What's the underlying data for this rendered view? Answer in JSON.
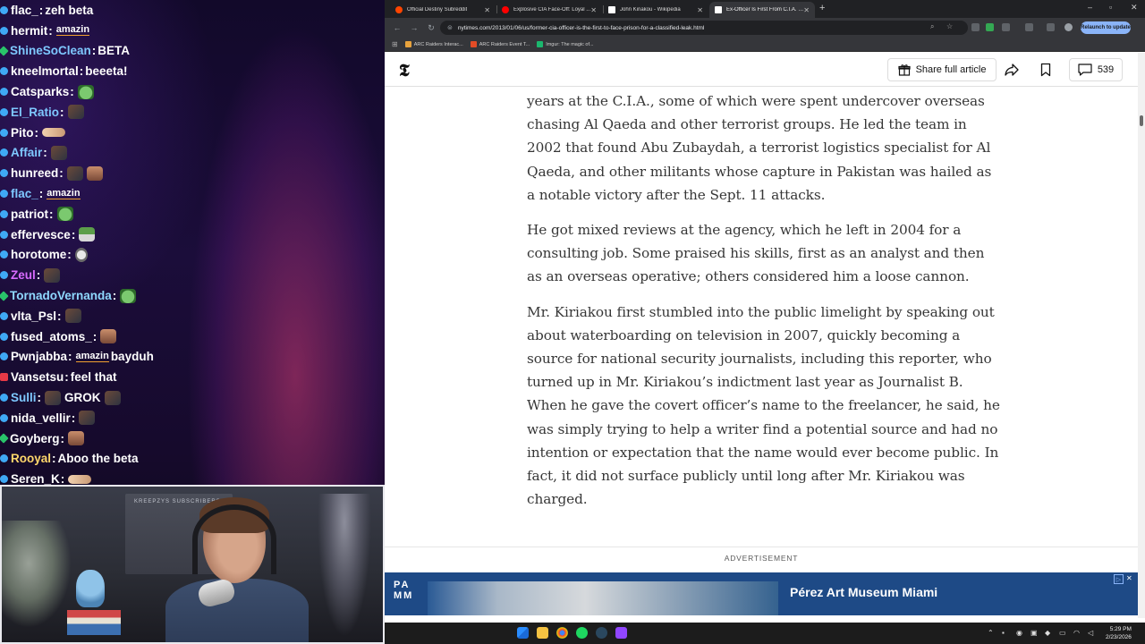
{
  "chat": [
    {
      "user": "flac_",
      "user_color": "#ffffff",
      "badge": "blue",
      "text": "zeh beta",
      "emotes": []
    },
    {
      "user": "hermit",
      "user_color": "#ffffff",
      "badge": "blue",
      "text": "",
      "emotes": [
        "amazin"
      ]
    },
    {
      "user": "ShineSoClean",
      "user_color": "#7ec8ff",
      "badge": "green",
      "text": "BETA",
      "emotes": []
    },
    {
      "user": "kneelmortal",
      "user_color": "#ffffff",
      "badge": "blue",
      "text": "beeeta!",
      "emotes": []
    },
    {
      "user": "Catsparks",
      "user_color": "#ffffff",
      "badge": "blue",
      "text": "",
      "emotes": [
        "frog"
      ]
    },
    {
      "user": "El_Ratio",
      "user_color": "#7ec8ff",
      "badge": "blue",
      "text": "",
      "emotes": [
        "face"
      ]
    },
    {
      "user": "Pito",
      "user_color": "#ffffff",
      "badge": "blue",
      "text": "",
      "emotes": [
        "hand"
      ]
    },
    {
      "user": "Affair",
      "user_color": "#7ec8ff",
      "badge": "blue",
      "text": "",
      "emotes": [
        "face"
      ]
    },
    {
      "user": "hunreed",
      "user_color": "#ffffff",
      "badge": "blue",
      "text": "",
      "emotes": [
        "face",
        "man"
      ]
    },
    {
      "user": "flac_",
      "user_color": "#7ec8ff",
      "badge": "blue",
      "text": "",
      "emotes": [
        "amazin"
      ]
    },
    {
      "user": "patriot",
      "user_color": "#ffffff",
      "badge": "blue",
      "text": "",
      "emotes": [
        "frog"
      ]
    },
    {
      "user": "effervesce",
      "user_color": "#ffffff",
      "badge": "blue",
      "text": "",
      "emotes": [
        "flag"
      ]
    },
    {
      "user": "horotome",
      "user_color": "#ffffff",
      "badge": "blue",
      "text": "",
      "emotes": [
        "skull"
      ]
    },
    {
      "user": "Zeul",
      "user_color": "#d86bff",
      "badge": "blue",
      "text": "",
      "emotes": [
        "face"
      ]
    },
    {
      "user": "TornadoVernanda",
      "user_color": "#8fd9ff",
      "badge": "green",
      "text": "",
      "emotes": [
        "frog"
      ]
    },
    {
      "user": "vlta_Psl",
      "user_color": "#ffffff",
      "badge": "blue",
      "text": "",
      "emotes": [
        "face"
      ]
    },
    {
      "user": "fused_atoms_",
      "user_color": "#ffffff",
      "badge": "blue",
      "text": "",
      "emotes": [
        "man"
      ]
    },
    {
      "user": "Pwnjabba",
      "user_color": "#ffffff",
      "badge": "blue",
      "text": "bayduh",
      "emotes": [
        "amazin"
      ]
    },
    {
      "user": "Vansetsu",
      "user_color": "#ffffff",
      "badge": "red",
      "text": "feel that",
      "emotes": []
    },
    {
      "user": "Sulli",
      "user_color": "#7ec8ff",
      "badge": "blue",
      "text": "GROK",
      "emotes": [
        "face",
        "face"
      ]
    },
    {
      "user": "nida_vellir",
      "user_color": "#ffffff",
      "badge": "blue",
      "text": "",
      "emotes": [
        "face"
      ]
    },
    {
      "user": "Goyberg",
      "user_color": "#ffffff",
      "badge": "green",
      "text": "",
      "emotes": [
        "man"
      ]
    },
    {
      "user": "Rooyal",
      "user_color": "#ffd76b",
      "badge": "blue",
      "text": "Aboo the beta",
      "emotes": []
    },
    {
      "user": "Seren_K",
      "user_color": "#ffffff",
      "badge": "blue",
      "text": "",
      "emotes": [
        "hand"
      ]
    }
  ],
  "webcam": {
    "shelf_text": "KREEPZYS SUBSCRIBERS"
  },
  "browser": {
    "tabs": [
      {
        "label": "Official Destiny Subreddit",
        "color": "#ff4500"
      },
      {
        "label": "Explosive CIA Face-Off: Loyal ...",
        "color": "#ff0000"
      },
      {
        "label": "John Kiriakou - Wikipedia",
        "color": "#ffffff"
      },
      {
        "label": "Ex-Officer Is First From C.I.A. to...",
        "color": "#ffffff"
      }
    ],
    "url": "nytimes.com/2013/01/06/us/former-cia-officer-is-the-first-to-face-prison-for-a-classified-leak.html",
    "relaunch_label": "Relaunch to update",
    "bookmarks": [
      {
        "label": "ARC Raiders Interac...",
        "color": "#e8a33d"
      },
      {
        "label": "ARC Raiders Event T...",
        "color": "#e34c26"
      },
      {
        "label": "Imgur: The magic of...",
        "color": "#1bb76e"
      }
    ]
  },
  "site": {
    "logo": "𝕿",
    "share_label": "Share full article",
    "comment_count": "539"
  },
  "article": {
    "paragraphs": [
      "years at the C.I.A., some of which were spent undercover overseas chasing Al Qaeda and other terrorist groups. He led the team in 2002 that found Abu Zubaydah, a terrorist logistics specialist for Al Qaeda, and other militants whose capture in Pakistan was hailed as a notable victory after the Sept. 11 attacks.",
      "He got mixed reviews at the agency, which he left in 2004 for a consulting job. Some praised his skills, first as an analyst and then as an overseas operative; others considered him a loose cannon.",
      "Mr. Kiriakou first stumbled into the public limelight by speaking out about waterboarding on television in 2007, quickly becoming a source for national security journalists, including this reporter, who turned up in Mr. Kiriakou’s indictment last year as Journalist B. When he gave the covert officer’s name to the freelancer, he said, he was simply trying to help a writer find a potential source and had no intention or expectation that the name would ever become public. In fact, it did not surface publicly until long after Mr. Kiriakou was charged."
    ]
  },
  "ad": {
    "label": "ADVERTISEMENT",
    "logo": "PAMM",
    "title": "Pérez Art Museum Miami"
  },
  "taskbar": {
    "time": "5:29 PM",
    "date": "2/23/2026"
  }
}
